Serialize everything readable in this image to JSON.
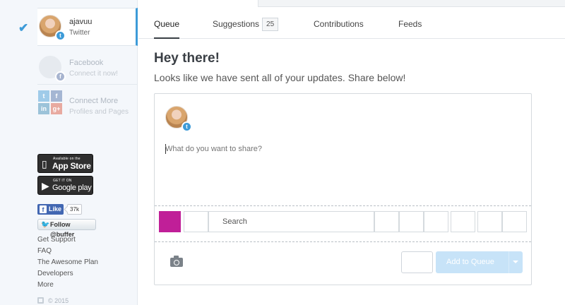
{
  "sidebar": {
    "profiles": [
      {
        "name": "ajavuu",
        "network": "Twitter",
        "active": true
      },
      {
        "name": "Facebook",
        "subtitle": "Connect it now!"
      },
      {
        "name": "Connect More",
        "subtitle": "Profiles and Pages"
      }
    ],
    "app_store": {
      "small": "Available on the",
      "big": "App Store"
    },
    "google_play": {
      "small": "GET IT ON",
      "big": "Google play"
    },
    "fb_like": {
      "label": "Like",
      "count": "37k"
    },
    "twitter_follow": {
      "label": "Follow @buffer"
    },
    "links": [
      "Get Support",
      "FAQ",
      "The Awesome Plan",
      "Developers",
      "More"
    ],
    "copyright": "© 2015"
  },
  "tabs": [
    {
      "label": "Queue",
      "active": true
    },
    {
      "label": "Suggestions",
      "badge": "25"
    },
    {
      "label": "Contributions"
    },
    {
      "label": "Feeds"
    }
  ],
  "main": {
    "greeting": "Hey there!",
    "subtitle": "Looks like we have sent all of your updates. Share below!"
  },
  "composer": {
    "placeholder": "What do you want to share?",
    "search_label": "Search",
    "add_button": "Add to Queue",
    "colors": {
      "swatch": "#c01f98",
      "accent": "#3d9bd8",
      "add_button_bg": "#c7e3f8"
    }
  },
  "icons": [
    "check-icon",
    "twitter-icon",
    "facebook-icon",
    "apple-icon",
    "google-play-icon",
    "camera-icon",
    "chevron-down-icon",
    "buffer-logo-icon"
  ]
}
